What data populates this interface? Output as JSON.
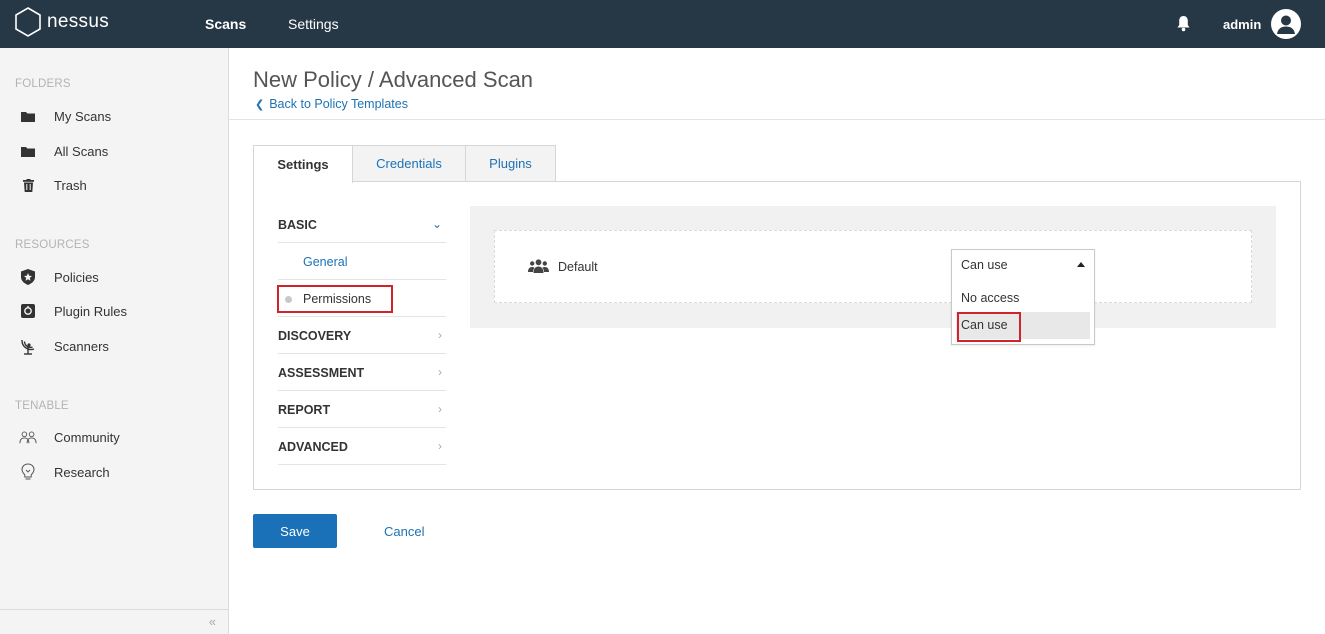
{
  "topbar": {
    "brand": "nessus",
    "nav": [
      {
        "label": "Scans"
      },
      {
        "label": "Settings"
      }
    ],
    "user": "admin",
    "bg_color": "#263746"
  },
  "sidebar": {
    "sections": [
      {
        "heading": "FOLDERS",
        "items": [
          {
            "label": "My Scans",
            "icon": "folder-icon"
          },
          {
            "label": "All Scans",
            "icon": "folder-icon"
          },
          {
            "label": "Trash",
            "icon": "trash-icon"
          }
        ]
      },
      {
        "heading": "RESOURCES",
        "items": [
          {
            "label": "Policies",
            "icon": "shield-star-icon"
          },
          {
            "label": "Plugin Rules",
            "icon": "plugin-icon"
          },
          {
            "label": "Scanners",
            "icon": "radar-icon"
          }
        ]
      },
      {
        "heading": "TENABLE",
        "items": [
          {
            "label": "Community",
            "icon": "community-icon"
          },
          {
            "label": "Research",
            "icon": "lightbulb-icon"
          }
        ]
      }
    ],
    "collapse_glyph": "«"
  },
  "header": {
    "title": "New Policy / Advanced Scan",
    "back_link": "Back to Policy Templates"
  },
  "tabs": [
    {
      "label": "Settings",
      "active": true
    },
    {
      "label": "Credentials",
      "active": false
    },
    {
      "label": "Plugins",
      "active": false
    }
  ],
  "settings_menu": {
    "basic": {
      "label": "BASIC",
      "children": [
        {
          "label": "General"
        },
        {
          "label": "Permissions"
        }
      ]
    },
    "others": [
      {
        "label": "DISCOVERY"
      },
      {
        "label": "ASSESSMENT"
      },
      {
        "label": "REPORT"
      },
      {
        "label": "ADVANCED"
      }
    ]
  },
  "permissions": {
    "entity": "Default",
    "selected": "Can use",
    "options": [
      "No access",
      "Can use"
    ]
  },
  "actions": {
    "save": "Save",
    "cancel": "Cancel"
  },
  "colors": {
    "accent": "#1a71b8",
    "link": "#1c72b5",
    "highlight": "#d0242c"
  }
}
